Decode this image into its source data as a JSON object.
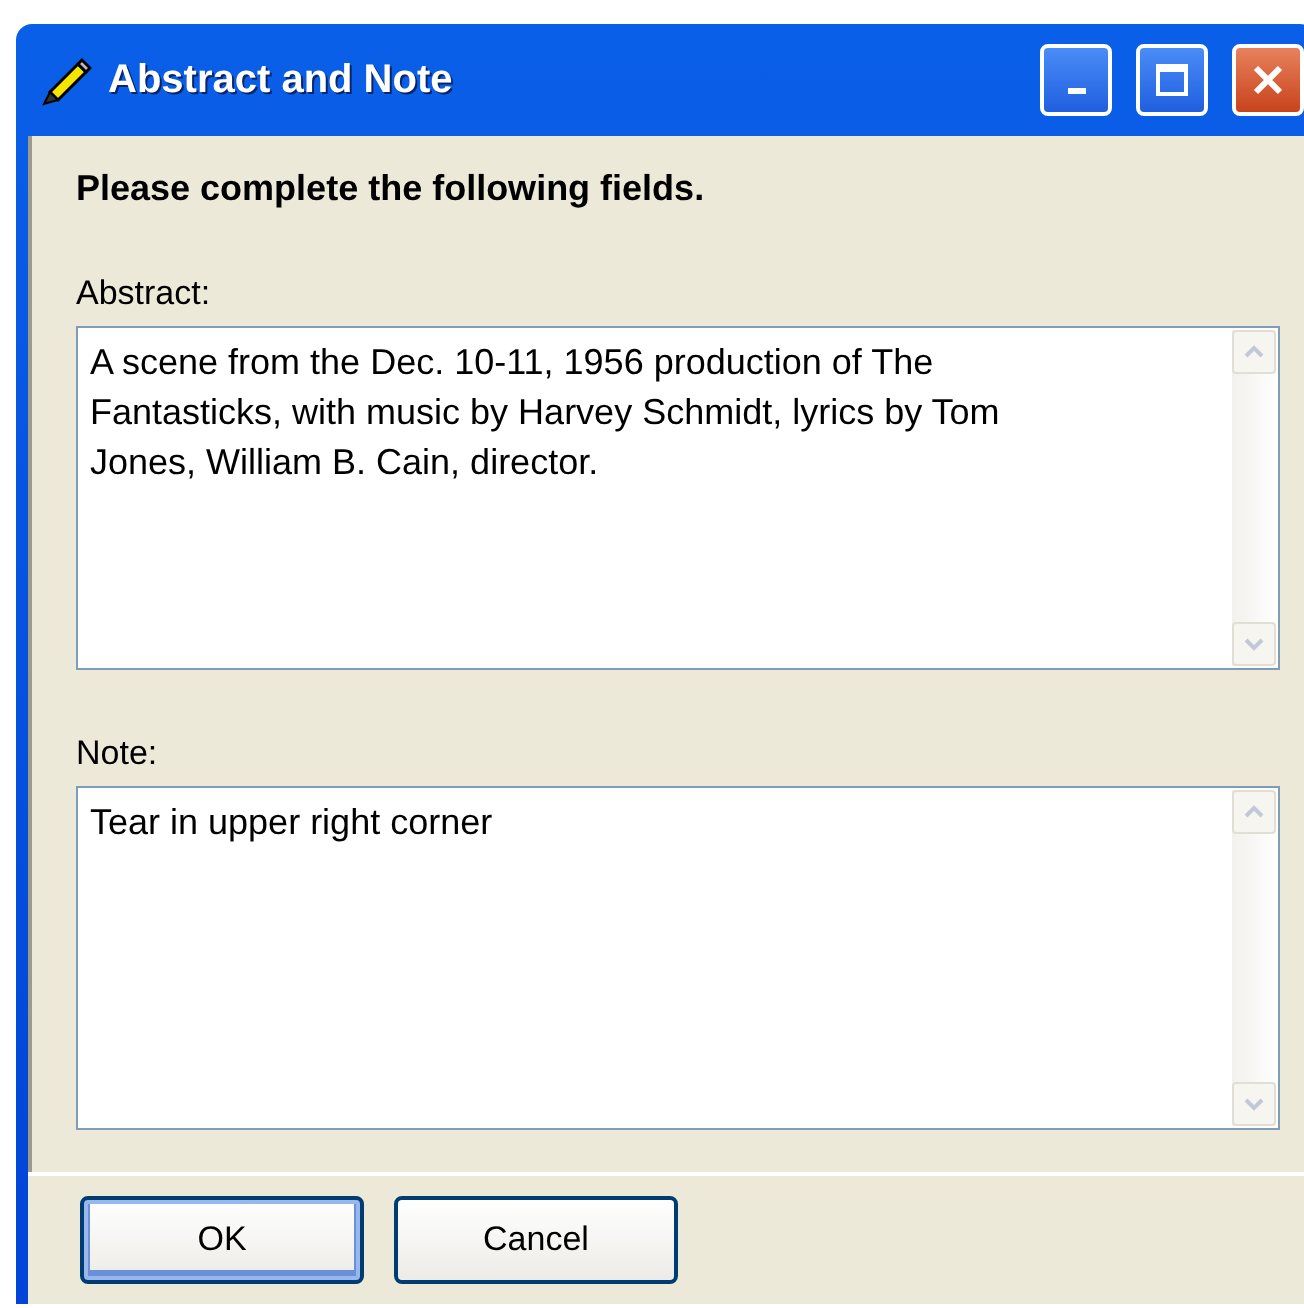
{
  "window": {
    "title": "Abstract and Note"
  },
  "instruction": "Please complete the following fields.",
  "fields": [
    {
      "label": "Abstract:",
      "value": "A scene from the Dec. 10-11, 1956 production of The Fantasticks, with music by Harvey Schmidt, lyrics by Tom Jones, William B. Cain, director."
    },
    {
      "label": "Note:",
      "value": "Tear in upper right corner"
    }
  ],
  "buttons": [
    {
      "label": "OK",
      "default": true
    },
    {
      "label": "Cancel",
      "default": false
    }
  ]
}
